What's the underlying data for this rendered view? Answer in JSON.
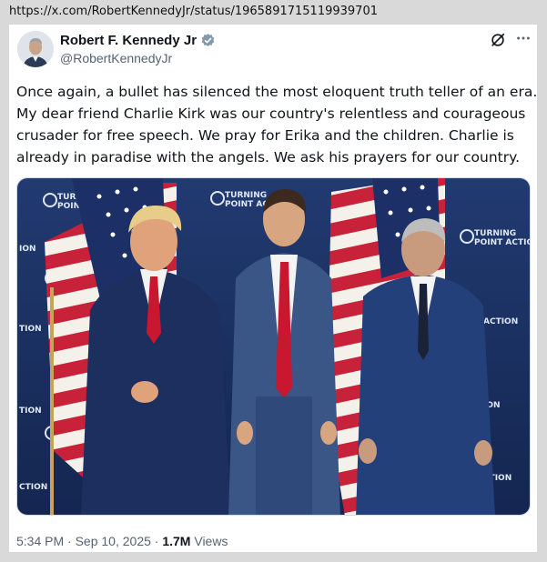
{
  "browser": {
    "url": "https://x.com/RobertKennedyJr/status/1965891715119939701"
  },
  "tweet": {
    "author_name": "Robert F. Kennedy Jr",
    "handle": "@RobertKennedyJr",
    "text_lines": [
      "Once again, a bullet has silenced the most eloquent truth teller of an era.",
      "My dear friend Charlie Kirk was our country's relentless and courageous",
      "crusader for free speech. We pray for Erika and the children. Charlie is",
      "already in paradise with the angels. We ask his prayers for our country."
    ],
    "time": "5:34 PM",
    "separator": "·",
    "date": "Sep 10, 2025",
    "views_count": "1.7M",
    "views_label": "Views"
  },
  "photo": {
    "backdrop_logo_line1": "TURNING",
    "backdrop_logo_line2": "POINT ACTION"
  },
  "icons": {
    "verified": "verified-badge-icon",
    "grok": "grok-icon",
    "more": "more-options-icon"
  },
  "colors": {
    "verified_badge": "#829aab",
    "backdrop": "#1b2c5a",
    "link_text": "#536471"
  }
}
